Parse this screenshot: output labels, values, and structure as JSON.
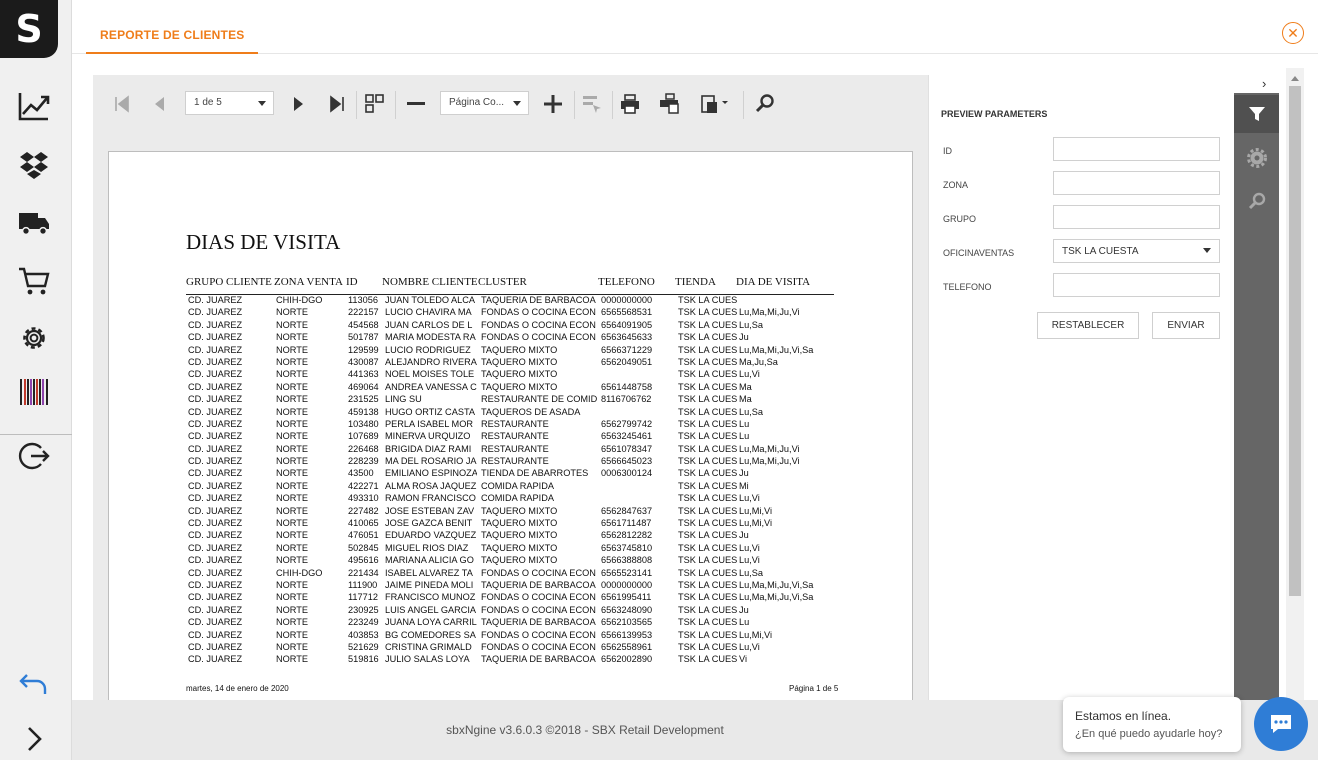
{
  "app": {
    "logo": "S",
    "footer": "sbxNgine v3.6.0.3 ©2018 - SBX Retail Development"
  },
  "header": {
    "tab": "REPORTE DE CLIENTES"
  },
  "sidebar": {
    "items": [
      "chart-icon",
      "dropbox-icon",
      "truck-icon",
      "cart-icon",
      "gear-icon",
      "barcode-icon",
      "logout-icon"
    ]
  },
  "toolbar": {
    "page_select": "1 de 5",
    "zoom_select": "Página Co..."
  },
  "report": {
    "title": "DIAS DE VISITA",
    "columns": [
      "GRUPO CLIENTE",
      "ZONA VENTA",
      "ID",
      "NOMBRE CLIENTE",
      "CLUSTER",
      "TELEFONO",
      "TIENDA",
      "DIA DE VISITA"
    ],
    "rows": [
      [
        "CD. JUAREZ",
        "CHIH-DGO",
        "113056",
        "JUAN TOLEDO ALCA",
        "TAQUERIA DE BARBACOA",
        "0000000000",
        "TSK LA CUES",
        ""
      ],
      [
        "CD. JUAREZ",
        "NORTE",
        "222157",
        "LUCIO CHAVIRA MA",
        "FONDAS O COCINA ECON",
        "6565568531",
        "TSK LA CUES",
        "Lu,Ma,Mi,Ju,Vi"
      ],
      [
        "CD. JUAREZ",
        "NORTE",
        "454568",
        "JUAN CARLOS DE L",
        "FONDAS O COCINA ECON",
        "6564091905",
        "TSK LA CUES",
        "Lu,Sa"
      ],
      [
        "CD. JUAREZ",
        "NORTE",
        "501787",
        "MARIA MODESTA RA",
        "FONDAS O COCINA ECON",
        "6563645633",
        "TSK LA CUES",
        "Ju"
      ],
      [
        "CD. JUAREZ",
        "NORTE",
        "129599",
        "LUCIO RODRIGUEZ",
        "TAQUERO MIXTO",
        "6566371229",
        "TSK LA CUES",
        "Lu,Ma,Mi,Ju,Vi,Sa"
      ],
      [
        "CD. JUAREZ",
        "NORTE",
        "430087",
        "ALEJANDRO RIVERA",
        "TAQUERO MIXTO",
        "6562049051",
        "TSK LA CUES",
        "Ma,Ju,Sa"
      ],
      [
        "CD. JUAREZ",
        "NORTE",
        "441363",
        "NOEL MOISES TOLE",
        "TAQUERO MIXTO",
        "",
        "TSK LA CUES",
        "Lu,Vi"
      ],
      [
        "CD. JUAREZ",
        "NORTE",
        "469064",
        "ANDREA VANESSA C",
        "TAQUERO MIXTO",
        "6561448758",
        "TSK LA CUES",
        "Ma"
      ],
      [
        "CD. JUAREZ",
        "NORTE",
        "231525",
        "LING SU",
        "RESTAURANTE DE COMID",
        "8116706762",
        "TSK LA CUES",
        "Ma"
      ],
      [
        "CD. JUAREZ",
        "NORTE",
        "459138",
        "HUGO ORTIZ CASTA",
        "TAQUEROS DE ASADA",
        "",
        "TSK LA CUES",
        "Lu,Sa"
      ],
      [
        "CD. JUAREZ",
        "NORTE",
        "103480",
        "PERLA ISABEL MOR",
        "RESTAURANTE",
        "6562799742",
        "TSK LA CUES",
        "Lu"
      ],
      [
        "CD. JUAREZ",
        "NORTE",
        "107689",
        "MINERVA URQUIZO",
        "RESTAURANTE",
        "6563245461",
        "TSK LA CUES",
        "Lu"
      ],
      [
        "CD. JUAREZ",
        "NORTE",
        "226468",
        "BRIGIDA DIAZ RAMI",
        "RESTAURANTE",
        "6561078347",
        "TSK LA CUES",
        "Lu,Ma,Mi,Ju,Vi"
      ],
      [
        "CD. JUAREZ",
        "NORTE",
        "228239",
        "MA DEL ROSARIO JA",
        "RESTAURANTE",
        "6566645023",
        "TSK LA CUES",
        "Lu,Ma,Mi,Ju,Vi"
      ],
      [
        "CD. JUAREZ",
        "NORTE",
        "43500",
        "EMILIANO ESPINOZA",
        "TIENDA DE ABARROTES",
        "0006300124",
        "TSK LA CUES",
        "Ju"
      ],
      [
        "CD. JUAREZ",
        "NORTE",
        "422271",
        "ALMA ROSA JAQUEZ",
        "COMIDA RAPIDA",
        "",
        "TSK LA CUES",
        "Mi"
      ],
      [
        "CD. JUAREZ",
        "NORTE",
        "493310",
        "RAMON FRANCISCO",
        "COMIDA RAPIDA",
        "",
        "TSK LA CUES",
        "Lu,Vi"
      ],
      [
        "CD. JUAREZ",
        "NORTE",
        "227482",
        "JOSE ESTEBAN ZAV",
        "TAQUERO MIXTO",
        "6562847637",
        "TSK LA CUES",
        "Lu,Mi,Vi"
      ],
      [
        "CD. JUAREZ",
        "NORTE",
        "410065",
        "JOSE GAZCA BENIT",
        "TAQUERO MIXTO",
        "6561711487",
        "TSK LA CUES",
        "Lu,Mi,Vi"
      ],
      [
        "CD. JUAREZ",
        "NORTE",
        "476051",
        "EDUARDO VAZQUEZ",
        "TAQUERO MIXTO",
        "6562812282",
        "TSK LA CUES",
        "Ju"
      ],
      [
        "CD. JUAREZ",
        "NORTE",
        "502845",
        "MIGUEL RIOS DIAZ",
        "TAQUERO MIXTO",
        "6563745810",
        "TSK LA CUES",
        "Lu,Vi"
      ],
      [
        "CD. JUAREZ",
        "NORTE",
        "495616",
        "MARIANA ALICIA GO",
        "TAQUERO MIXTO",
        "6566388808",
        "TSK LA CUES",
        "Lu,Vi"
      ],
      [
        "CD. JUAREZ",
        "CHIH-DGO",
        "221434",
        "ISABEL ALVAREZ TA",
        "FONDAS O COCINA ECON",
        "6565523141",
        "TSK LA CUES",
        "Lu,Sa"
      ],
      [
        "CD. JUAREZ",
        "NORTE",
        "111900",
        "JAIME PINEDA MOLI",
        "TAQUERIA DE BARBACOA",
        "0000000000",
        "TSK LA CUES",
        "Lu,Ma,Mi,Ju,Vi,Sa"
      ],
      [
        "CD. JUAREZ",
        "NORTE",
        "117712",
        "FRANCISCO MUNOZ",
        "FONDAS O COCINA ECON",
        "6561995411",
        "TSK LA CUES",
        "Lu,Ma,Mi,Ju,Vi,Sa"
      ],
      [
        "CD. JUAREZ",
        "NORTE",
        "230925",
        "LUIS ANGEL GARCIA",
        "FONDAS O COCINA ECON",
        "6563248090",
        "TSK LA CUES",
        "Ju"
      ],
      [
        "CD. JUAREZ",
        "NORTE",
        "223249",
        "JUANA LOYA CARRIL",
        "TAQUERIA DE BARBACOA",
        "6562103565",
        "TSK LA CUES",
        "Lu"
      ],
      [
        "CD. JUAREZ",
        "NORTE",
        "403853",
        "BG COMEDORES SA",
        "FONDAS O COCINA ECON",
        "6566139953",
        "TSK LA CUES",
        "Lu,Mi,Vi"
      ],
      [
        "CD. JUAREZ",
        "NORTE",
        "521629",
        "CRISTINA GRIMALD",
        "FONDAS O COCINA ECON",
        "6562558961",
        "TSK LA CUES",
        "Lu,Vi"
      ],
      [
        "CD. JUAREZ",
        "NORTE",
        "519816",
        "JULIO SALAS LOYA",
        "TAQUERIA DE BARBACOA",
        "6562002890",
        "TSK LA CUES",
        "Vi"
      ]
    ],
    "footer_date": "martes, 14 de enero de 2020",
    "footer_page": "Página 1 de 5"
  },
  "params": {
    "title": "PREVIEW PARAMETERS",
    "fields": [
      {
        "label": "ID",
        "value": ""
      },
      {
        "label": "ZONA",
        "value": ""
      },
      {
        "label": "GRUPO",
        "value": ""
      },
      {
        "label": "OFICINAVENTAS",
        "value": "TSK LA CUESTA"
      },
      {
        "label": "TELEFONO",
        "value": ""
      }
    ],
    "reset": "RESTABLECER",
    "send": "ENVIAR"
  },
  "chat": {
    "line1": "Estamos en línea.",
    "line2": "¿En qué puedo ayudarle hoy?"
  }
}
